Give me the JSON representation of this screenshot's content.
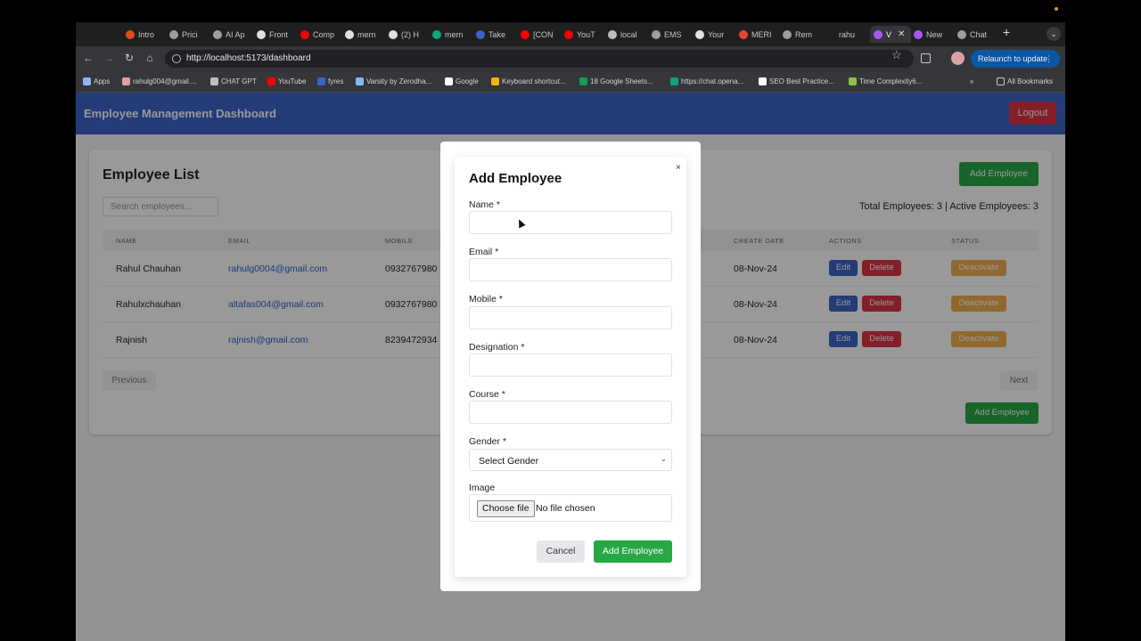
{
  "browser": {
    "tabs": [
      {
        "label": "Intro",
        "color": "#e64a19"
      },
      {
        "label": "Prici",
        "color": "#9e9e9e"
      },
      {
        "label": "AI Ap",
        "color": "#9e9e9e"
      },
      {
        "label": "Front",
        "color": "#e0e0e0"
      },
      {
        "label": "Comp",
        "color": "#ff0000"
      },
      {
        "label": "mern",
        "color": "#e0e0e0"
      },
      {
        "label": "(2) H",
        "color": "#e0e0e0"
      },
      {
        "label": "mern",
        "color": "#10a37f"
      },
      {
        "label": "Take",
        "color": "#3b63c6"
      },
      {
        "label": "[CON",
        "color": "#ff0000"
      },
      {
        "label": "YouT",
        "color": "#ff0000"
      },
      {
        "label": "local",
        "color": "#bdbdbd"
      },
      {
        "label": "EMS",
        "color": "#9e9e9e"
      },
      {
        "label": "Your",
        "color": "#e0e0e0"
      },
      {
        "label": "MERI",
        "color": "#ea4335"
      },
      {
        "label": "Rem",
        "color": "#9e9e9e"
      },
      {
        "label": "rahu",
        "color": "#1f1f1f"
      },
      {
        "label": "V",
        "color": "#a855f7"
      },
      {
        "label": "New",
        "color": "#a855f7"
      },
      {
        "label": "Chat",
        "color": "#9e9e9e"
      }
    ],
    "new_tab_symbol": "+",
    "tab_menu_symbol": "⌄",
    "close_symbol": "✕",
    "url": "http://localhost:5173/dashboard",
    "relaunch_label": "Relaunch to update",
    "bookmarks": [
      {
        "label": "Apps",
        "color": "#8ab4f8"
      },
      {
        "label": "rahulg004@gmail....",
        "color": "#d9a3a3"
      },
      {
        "label": "CHAT GPT",
        "color": "#bdbdbd"
      },
      {
        "label": "YouTube",
        "color": "#ff0000"
      },
      {
        "label": "fyres",
        "color": "#3b63c6"
      },
      {
        "label": "Varsity by Zerodha...",
        "color": "#8ab4f8"
      },
      {
        "label": "Google",
        "color": "#ffffff"
      },
      {
        "label": "Keyboard shortcut...",
        "color": "#f4b400"
      },
      {
        "label": "18 Google Sheets...",
        "color": "#0f9d58"
      },
      {
        "label": "https://chat.opena...",
        "color": "#10a37f"
      },
      {
        "label": "SEO Best Practice...",
        "color": "#ffffff"
      },
      {
        "label": "Time Complexity6...",
        "color": "#8bc34a"
      }
    ],
    "more_bookmarks": "»",
    "all_bookmarks": "All Bookmarks"
  },
  "app": {
    "title": "Employee Management Dashboard",
    "logout_label": "Logout",
    "list_title": "Employee List",
    "add_employee_label": "Add Employee",
    "search_placeholder": "Search employees...",
    "totals": "Total Employees: 3 | Active Employees: 3",
    "columns": [
      "NAME",
      "EMAIL",
      "MOBILE",
      "CREATE DATE",
      "ACTIONS",
      "STATUS"
    ],
    "rows": [
      {
        "name": "Rahul Chauhan",
        "email": "rahulg0004@gmail.com",
        "mobile": "0932767980",
        "date": "08-Nov-24"
      },
      {
        "name": "Rahulxchauhan",
        "email": "altafas004@gmail.com",
        "mobile": "0932767980",
        "date": "08-Nov-24"
      },
      {
        "name": "Rajnish",
        "email": "rajnish@gmail.com",
        "mobile": "8239472934",
        "date": "08-Nov-24"
      }
    ],
    "edit_label": "Edit",
    "delete_label": "Delete",
    "deactivate_label": "Deactivate",
    "previous_label": "Previous",
    "next_label": "Next"
  },
  "modal": {
    "title": "Add Employee",
    "close_symbol": "×",
    "fields": {
      "name_label": "Name *",
      "email_label": "Email *",
      "mobile_label": "Mobile *",
      "designation_label": "Designation *",
      "course_label": "Course *",
      "gender_label": "Gender *",
      "gender_value": "Select Gender",
      "image_label": "Image",
      "choose_file": "Choose file",
      "no_file": "No file chosen"
    },
    "cancel_label": "Cancel",
    "submit_label": "Add Employee"
  }
}
